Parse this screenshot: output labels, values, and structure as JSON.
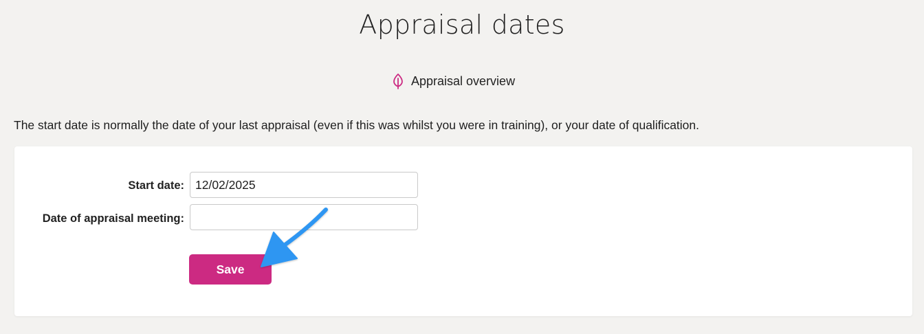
{
  "page": {
    "title": "Appraisal dates"
  },
  "overview_link": {
    "label": "Appraisal overview",
    "icon": "leaf-icon",
    "icon_color": "#cc2a82"
  },
  "intro_text": "The start date is normally the date of your last appraisal (even if this was whilst you were in training), or your date of qualification.",
  "form": {
    "start_date": {
      "label": "Start date:",
      "value": "12/02/2025"
    },
    "meeting_date": {
      "label": "Date of appraisal meeting:",
      "value": ""
    },
    "save_label": "Save"
  },
  "colors": {
    "background": "#f3f2f0",
    "card": "#ffffff",
    "accent": "#cc2a82",
    "annotation_arrow": "#2e96f2"
  }
}
